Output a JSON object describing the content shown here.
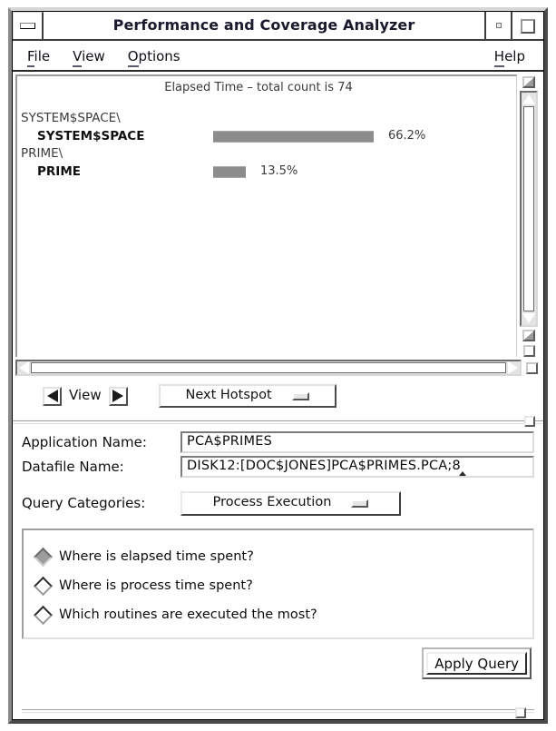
{
  "window": {
    "title": "Performance and Coverage Analyzer",
    "window_menu_icon": "window-menu-icon",
    "minimize_icon": "minimize-icon",
    "maximize_icon": "maximize-icon"
  },
  "menubar": {
    "items": [
      {
        "label": "File",
        "mnemonic": "F",
        "rest": "ile"
      },
      {
        "label": "View",
        "mnemonic": "V",
        "rest": "iew"
      },
      {
        "label": "Options",
        "mnemonic": "O",
        "rest": "ptions"
      }
    ],
    "help": {
      "label": "Help",
      "mnemonic": "H",
      "rest": "elp"
    }
  },
  "chart_data": {
    "type": "bar",
    "title": "Elapsed Time – total count is 74",
    "orientation": "horizontal",
    "total_count": 74,
    "xlabel": "",
    "ylabel": "",
    "xlim": [
      0,
      100
    ],
    "grid": false,
    "legend": "none",
    "value_unit": "%",
    "groups": [
      {
        "group_label": "SYSTEM$SPACE\\",
        "name": "SYSTEM$SPACE",
        "value": 66.2,
        "value_label": "66.2%"
      },
      {
        "group_label": "PRIME\\",
        "name": "PRIME",
        "value": 13.5,
        "value_label": "13.5%"
      }
    ],
    "categories": [
      "SYSTEM$SPACE",
      "PRIME"
    ],
    "values": [
      66.2,
      13.5
    ],
    "bar_color": "#8c8c8c"
  },
  "scrollbars": {
    "vertical": {
      "name": "vertical-scrollbar",
      "up_icon": "arrow-up-icon",
      "down_icon": "arrow-down-icon"
    },
    "horizontal": {
      "name": "horizontal-scrollbar",
      "left_icon": "arrow-left-icon",
      "right_icon": "arrow-right-icon"
    }
  },
  "view_controls": {
    "prev_icon": "arrow-left-icon",
    "next_icon": "arrow-right-icon",
    "label": "View",
    "hotspot_button": {
      "label": "Next Hotspot",
      "indicator_icon": "option-menu-indicator-icon"
    }
  },
  "form": {
    "application_name": {
      "label": "Application Name:",
      "value": "PCA$PRIMES",
      "placeholder": ""
    },
    "datafile_name": {
      "label": "Datafile Name:",
      "value": "DISK12:[DOC$JONES]PCA$PRIMES.PCA;8",
      "placeholder": ""
    },
    "query_categories": {
      "label": "Query Categories:",
      "value": "Process Execution",
      "indicator_icon": "option-menu-indicator-icon"
    }
  },
  "query_options": {
    "selected_index": 0,
    "items": [
      {
        "label": "Where is elapsed time spent?",
        "selected": true
      },
      {
        "label": "Where is process time spent?",
        "selected": false
      },
      {
        "label": "Which routines are executed the most?",
        "selected": false
      }
    ]
  },
  "actions": {
    "apply_query": "Apply Query"
  }
}
